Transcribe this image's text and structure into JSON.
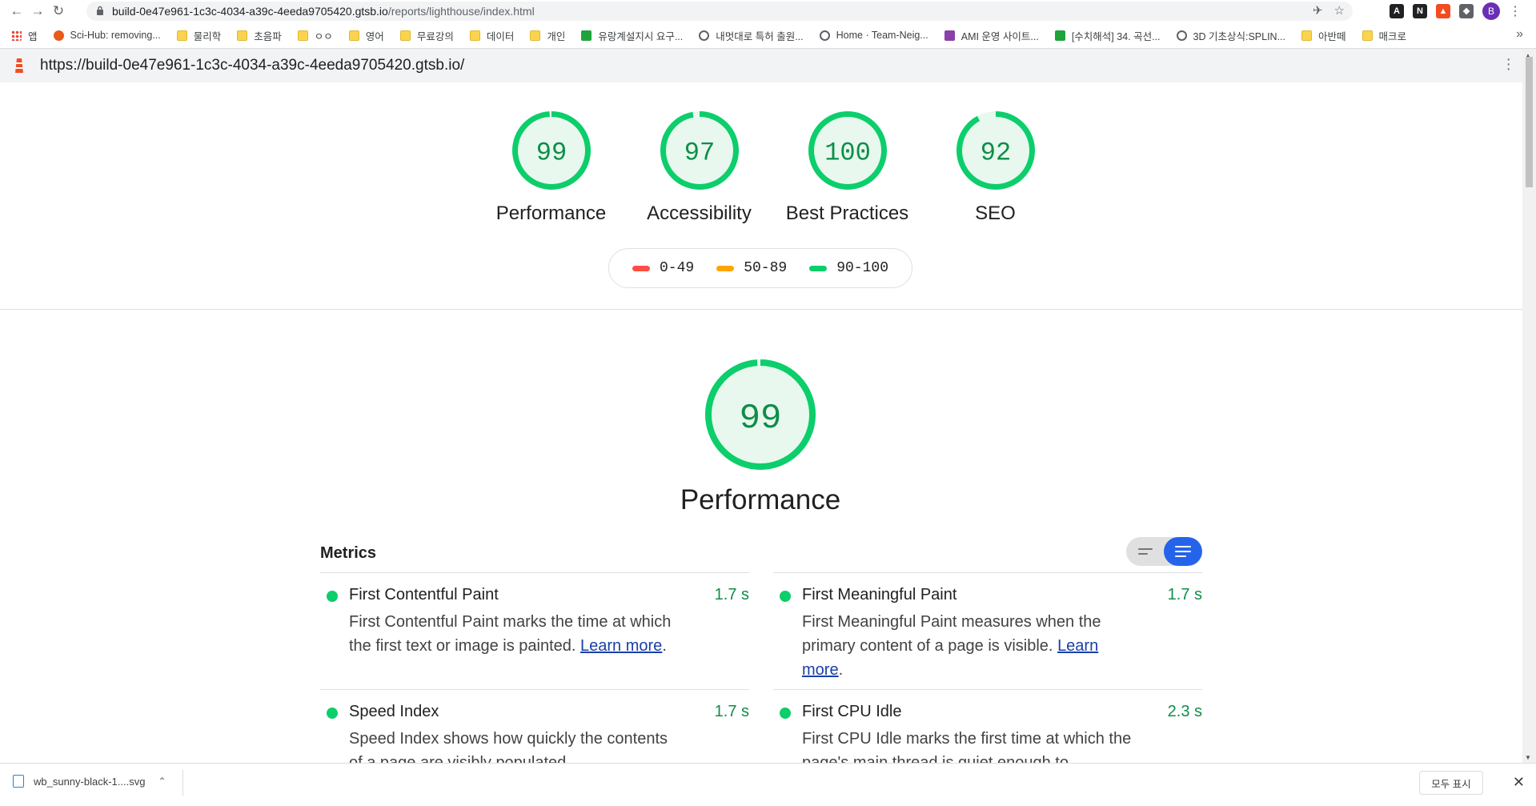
{
  "browser": {
    "url_host": "build-0e47e961-1c3c-4034-a39c-4eeda9705420.gtsb.io",
    "url_path": "/reports/lighthouse/index.html",
    "profile_initial": "B"
  },
  "bookmarks": [
    {
      "label": "앱",
      "icon": "apps-icon"
    },
    {
      "label": "Sci-Hub: removing...",
      "icon": "scihub-icon"
    },
    {
      "label": "물리학",
      "icon": "folder-icon"
    },
    {
      "label": "초음파",
      "icon": "folder-icon"
    },
    {
      "label": "ㅇㅇ",
      "icon": "folder-icon"
    },
    {
      "label": "영어",
      "icon": "folder-icon"
    },
    {
      "label": "무료강의",
      "icon": "folder-icon"
    },
    {
      "label": "데이터",
      "icon": "folder-icon"
    },
    {
      "label": "개인",
      "icon": "folder-icon"
    },
    {
      "label": "유랑계설지시 요구...",
      "icon": "green-icon"
    },
    {
      "label": "내멋대로 특허 출원...",
      "icon": "globe-icon"
    },
    {
      "label": "Home · Team-Neig...",
      "icon": "globe-icon"
    },
    {
      "label": "AMI 운영 사이트...",
      "icon": "purple-icon"
    },
    {
      "label": "[수치해석] 34. 곡선...",
      "icon": "green-icon"
    },
    {
      "label": "3D 기초상식:SPLIN...",
      "icon": "globe-icon"
    },
    {
      "label": "아반떼",
      "icon": "folder-icon"
    },
    {
      "label": "매크로",
      "icon": "folder-icon"
    }
  ],
  "lighthouse": {
    "report_url": "https://build-0e47e961-1c3c-4034-a39c-4eeda9705420.gtsb.io/",
    "gauges": [
      {
        "score": 99,
        "label": "Performance"
      },
      {
        "score": 97,
        "label": "Accessibility"
      },
      {
        "score": 100,
        "label": "Best Practices"
      },
      {
        "score": 92,
        "label": "SEO"
      }
    ],
    "legend": [
      {
        "range": "0-49",
        "color": "#ff4e42"
      },
      {
        "range": "50-89",
        "color": "#ffa400"
      },
      {
        "range": "90-100",
        "color": "#0cce6b"
      }
    ],
    "category": {
      "score": 99,
      "title": "Performance"
    },
    "metrics_heading": "Metrics",
    "metrics": [
      {
        "title": "First Contentful Paint",
        "value": "1.7 s",
        "desc": "First Contentful Paint marks the time at which the first text or image is painted.",
        "link": "Learn more"
      },
      {
        "title": "First Meaningful Paint",
        "value": "1.7 s",
        "desc": "First Meaningful Paint measures when the primary content of a page is visible.",
        "link": "Learn more"
      },
      {
        "title": "Speed Index",
        "value": "1.7 s",
        "desc": "Speed Index shows how quickly the contents of a page are visibly populated.",
        "link": ""
      },
      {
        "title": "First CPU Idle",
        "value": "2.3 s",
        "desc": "First CPU Idle marks the first time at which the page's main thread is quiet enough to",
        "link": ""
      }
    ],
    "pass_color": "#0cce6b"
  },
  "downloads": {
    "file_name": "wb_sunny-black-1....svg",
    "show_all": "모두 표시"
  }
}
